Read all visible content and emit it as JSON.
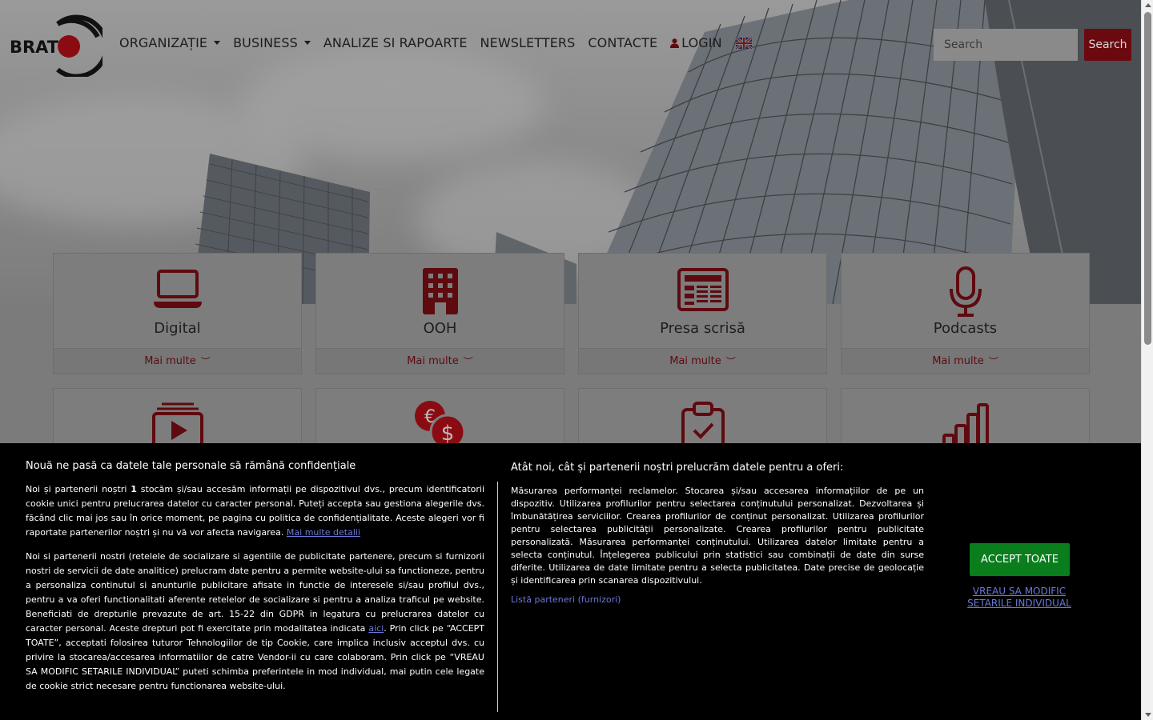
{
  "logo": {
    "text": "BRAT"
  },
  "nav": {
    "items": [
      {
        "label": "ORGANIZAȚIE",
        "dropdown": true
      },
      {
        "label": "BUSINESS",
        "dropdown": true
      },
      {
        "label": "ANALIZE SI RAPOARTE",
        "dropdown": false
      },
      {
        "label": "NEWSLETTERS",
        "dropdown": false
      },
      {
        "label": "CONTACTE",
        "dropdown": false
      }
    ],
    "login_label": "LOGIN",
    "language_flag": "uk-flag-icon"
  },
  "search": {
    "placeholder": "Search",
    "button_label": "Search"
  },
  "colors": {
    "brand_red": "#b5121b",
    "accept_green": "#0a7d1c",
    "link_blue": "#6b78d8"
  },
  "cards": [
    {
      "icon": "laptop-icon",
      "title": "Digital",
      "more_label": "Mai multe"
    },
    {
      "icon": "building-icon",
      "title": "OOH",
      "more_label": "Mai multe"
    },
    {
      "icon": "newspaper-icon",
      "title": "Presa scrisă",
      "more_label": "Mai multe"
    },
    {
      "icon": "microphone-icon",
      "title": "Podcasts",
      "more_label": "Mai multe"
    },
    {
      "icon": "video-play-icon"
    },
    {
      "icon": "currency-icon"
    },
    {
      "icon": "clipboard-check-icon"
    },
    {
      "icon": "bar-chart-icon"
    }
  ],
  "cookie": {
    "left_title": "Nouă ne pasă ca datele tale personale să rămână confidențiale",
    "p1_a": "Noi și partenerii noștri ",
    "p1_bold": "1",
    "p1_b": " stocăm și/sau accesăm informații pe dispozitivul dvs., precum identificatorii cookie unici pentru prelucrarea datelor cu caracter personal. Puteți accepta sau gestiona alegerile dvs. făcând clic mai jos sau în orice moment, pe pagina cu politica de confidențialitate. Aceste alegeri vor fi raportate partenerilor noștri și nu vă vor afecta navigarea. ",
    "p1_link": "Mai multe detalii",
    "p2_a": "Noi si partenerii nostri (retelele de socializare si agentiile de publicitate partenere, precum si furnizorii nostri de servicii de date analitice) prelucram date pentru a permite website-ului sa functioneze, pentru a personaliza continutul si anunturile publicitare afisate in functie de interesele si/sau profilul dvs., pentru a va oferi functionalitati aferente retelelor de socializare si pentru a analiza traficul pe website. Beneficiati de drepturile prevazute de art. 15-22 din GDPR in legatura cu prelucrarea datelor cu caracter personal. Aceste drepturi pot fi exercitate prin modalitatea indicata ",
    "p2_link": "aici",
    "p2_b": ". Prin click pe “ACCEPT TOATE”, acceptati folosirea tuturor Tehnologiilor de tip Cookie, care implica inclusiv acceptul dvs. cu privire la stocarea/accesarea informatiilor de catre Vendor-ii cu care colaboram. Prin click pe “VREAU SA MODIFIC SETARILE INDIVIDUAL” puteti schimba preferintele in mod individual, mai putin cele legate de cookie strict necesare pentru functionarea website-ului.",
    "right_title": "Atât noi, cât și partenerii noștri prelucrăm datele pentru a oferi:",
    "right_body": "Măsurarea performanței reclamelor. Stocarea și/sau accesarea informațiilor de pe un dispozitiv. Utilizarea profilurilor pentru selectarea conținutului personalizat. Dezvoltarea și îmbunătățirea serviciilor. Crearea profilurilor de conținut personalizat. Utilizarea profilurilor pentru selectarea publicității personalizate. Crearea profilurilor pentru publicitate personalizată. Măsurarea performanței conținutului. Utilizarea datelor limitate pentru a selecta conținutul. Înțelegerea publicului prin statistici sau combinații de date din surse diferite. Utilizarea de date limitate pentru a selecta publicitatea. Date precise de geolocație și identificarea prin scanarea dispozitivului.",
    "partners_link": "Listă parteneri (furnizori)",
    "accept_label": "ACCEPT TOATE",
    "modify_label": "VREAU SA MODIFIC SETARILE INDIVIDUAL"
  }
}
